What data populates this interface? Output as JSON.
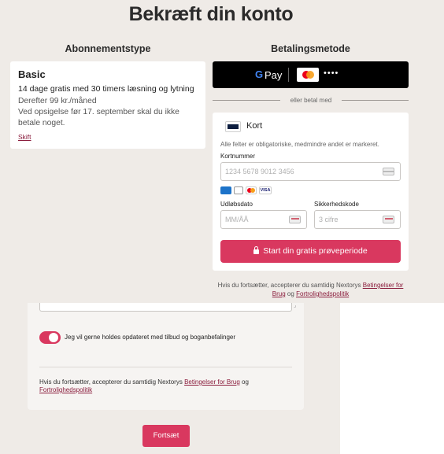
{
  "page": {
    "title": "Bekræft din konto"
  },
  "subscription": {
    "heading": "Abonnementstype",
    "plan_name": "Basic",
    "line1": "14 dage gratis med 30 timers læsning og lytning",
    "line2": "Derefter 99 kr./måned",
    "line3": "Ved opsigelse før 17. september skal du ikke betale noget.",
    "change_link": "Skift"
  },
  "payment": {
    "heading": "Betalingsmetode",
    "gpay_g": "G",
    "gpay_pay": "Pay",
    "gpay_masked": "••••",
    "or_text": "eller betal med",
    "card": {
      "title": "Kort",
      "required_note": "Alle felter er obligatoriske, medmindre andet er markeret.",
      "card_number_label": "Kortnummer",
      "card_number_placeholder": "1234 5678 9012 3456",
      "expiry_label": "Udløbsdato",
      "expiry_placeholder": "MM/ÅÅ",
      "cvc_label": "Sikkerhedskode",
      "cvc_placeholder": "3 cifre",
      "brand_visa": "VISA",
      "start_button": "Start din gratis prøveperiode"
    },
    "terms_prefix": "Hvis du fortsætter, accepterer du samtidig Nextorys",
    "terms_link": "Betingelser for Brug",
    "terms_and": "og",
    "privacy_link": "Fortrolighedspolitik"
  },
  "form": {
    "newsletter_label": "Jeg vil gerne holdes opdateret med tilbud og boganbefalinger",
    "newsletter_on": true,
    "terms_prefix": "Hvis du fortsætter, accepterer du samtidig Nextorys",
    "terms_link": "Betingelser for Brug",
    "terms_and": "og",
    "privacy_link": "Fortrolighedspolitik",
    "continue_button": "Fortsæt"
  },
  "colors": {
    "background": "#efebe7",
    "accent": "#d9385f",
    "link": "#8a1c3c"
  }
}
